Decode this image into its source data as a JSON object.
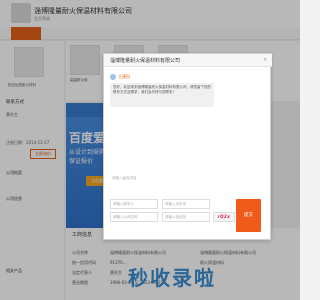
{
  "header": {
    "company_title": "淄博隆量耐火保温材料有限公司",
    "sub_title": "会员等级"
  },
  "left": {
    "product_label": "供应优质耐火材料",
    "contact_heading": "联系方式",
    "contact_person": "黄先生",
    "reg_date": "注册日期：2014-12-27",
    "message_button": "立即询价",
    "company_intro_heading": "公司档案",
    "company_info_heading": "公司信息",
    "related_heading": "相关产品"
  },
  "banner": {
    "big_text": "百度爱采购",
    "line1": "从设计到采购",
    "line2": "保证报价",
    "button": "点击查看"
  },
  "products": [
    {
      "label": "高温耐火砖"
    },
    {
      "label": "隔热保温板"
    },
    {
      "label": "耐火浇注料"
    }
  ],
  "lower": {
    "section": "工商信息",
    "rows": [
      {
        "k": "公司名称",
        "v": "淄博隆量耐火保温材料有限公司"
      },
      {
        "k": "统一信用代码",
        "v": "91370..."
      },
      {
        "k": "法定代表人",
        "v": "黄先生"
      },
      {
        "k": "营业期限",
        "v": "1996-03-26 至 2023-03-25"
      }
    ],
    "right_rows": [
      {
        "v": "淄博隆量耐火保温材料有限公司"
      },
      {
        "v": "耐火保温材料"
      }
    ]
  },
  "watermark": "秒收录啦",
  "dialog": {
    "title": "淄博隆量耐火保温材料有限公司",
    "close_glyph": "×",
    "sender": "王建田",
    "greeting": "您好，欢迎来到淄博隆量耐火保温材料有限公司，请您留下您的联系方式及需求，我们会尽快与您联系！",
    "message_placeholder": "请输入留言内容",
    "fields": {
      "name_placeholder": "请输入联系人",
      "phone_placeholder": "请输入手机号",
      "company_placeholder": "请输入公司名称",
      "captcha_placeholder": "请输入验证码"
    },
    "captcha_text": "rQ2x",
    "submit_label": "提交"
  },
  "colors": {
    "accent": "#e4611a",
    "submit": "#f05a1a",
    "link": "#2a64c5",
    "banner": "#3a7ccf"
  }
}
